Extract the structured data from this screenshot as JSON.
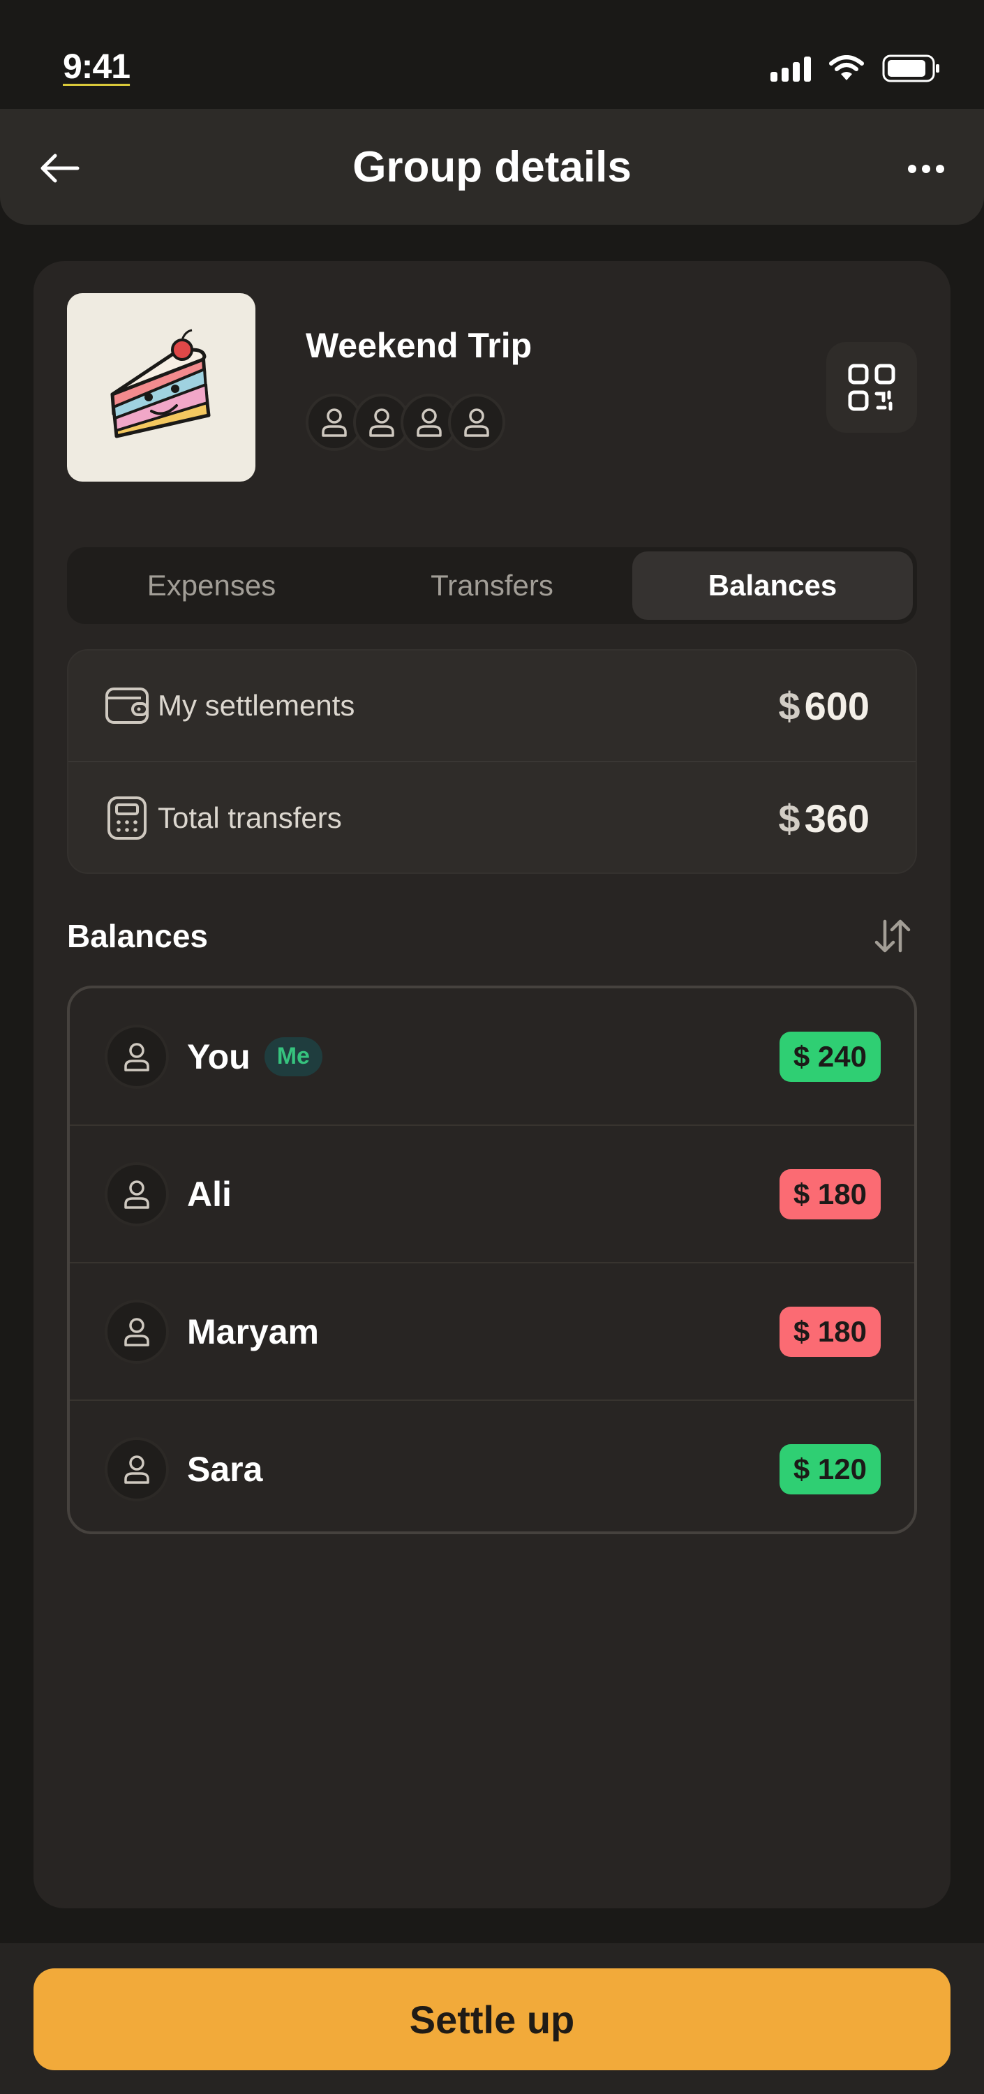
{
  "status_bar": {
    "time": "9:41"
  },
  "header": {
    "title": "Group details",
    "back_icon": "arrow-left-icon",
    "more_icon": "more-horizontal-icon"
  },
  "group": {
    "name": "Weekend Trip",
    "image_icon": "cake-slice-illustration",
    "member_count": 4,
    "qr_icon": "qr-code-icon"
  },
  "tabs": [
    {
      "label": "Expenses",
      "active": false
    },
    {
      "label": "Transfers",
      "active": false
    },
    {
      "label": "Balances",
      "active": true
    }
  ],
  "summary": {
    "settlements": {
      "label": "My settlements",
      "currency": "$",
      "value": "600",
      "icon": "wallet-icon"
    },
    "transfers": {
      "label": "Total transfers",
      "currency": "$",
      "value": "360",
      "icon": "calculator-icon"
    }
  },
  "balances": {
    "title": "Balances",
    "sort_icon": "sort-arrows-icon",
    "me_badge": "Me",
    "rows": [
      {
        "name": "You",
        "amount": "$ 240",
        "status": "positive",
        "is_me": true
      },
      {
        "name": "Ali",
        "amount": "$ 180",
        "status": "negative",
        "is_me": false
      },
      {
        "name": "Maryam",
        "amount": "$ 180",
        "status": "negative",
        "is_me": false
      },
      {
        "name": "Sara",
        "amount": "$ 120",
        "status": "positive",
        "is_me": false
      }
    ]
  },
  "footer": {
    "settle_label": "Settle up"
  },
  "colors": {
    "accent": "#f2aa3a",
    "positive": "#2fcf73",
    "negative": "#fb6b73",
    "background": "#1a1917",
    "card": "#282523"
  }
}
